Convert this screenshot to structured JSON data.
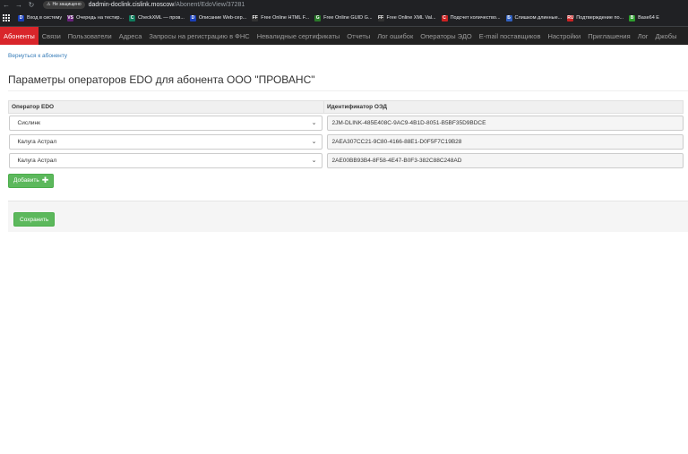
{
  "browser": {
    "security_label": "Не защищено",
    "url_host": "dadmin-doclink.cislink.moscow",
    "url_path": "/Abonent/EdoView/37281",
    "bookmarks": [
      {
        "label": "Вход в систему",
        "icon": "D",
        "color": "#1a3fb8"
      },
      {
        "label": "Очередь на тестир...",
        "icon": "VS",
        "color": "#68217a"
      },
      {
        "label": "CheckXML — пров...",
        "icon": "C",
        "color": "#0f7b5c"
      },
      {
        "label": "Описание Web-сер...",
        "icon": "D",
        "color": "#1a3fb8"
      },
      {
        "label": "Free Online HTML F...",
        "icon": "FF",
        "color": "#333333"
      },
      {
        "label": "Free Online GUID G...",
        "icon": "G",
        "color": "#2a7a2a"
      },
      {
        "label": "Free Online XML Val...",
        "icon": "FF",
        "color": "#333333"
      },
      {
        "label": "Подсчет количество...",
        "icon": "C",
        "color": "#cc2222"
      },
      {
        "label": "Слишком длинные...",
        "icon": "Б",
        "color": "#3060c0"
      },
      {
        "label": "Подтверждение по...",
        "icon": "RU",
        "color": "#cc2222"
      },
      {
        "label": "Base64 E",
        "icon": "B",
        "color": "#2e9e2e"
      }
    ]
  },
  "navbar": {
    "items": [
      "Абоненты",
      "Связи",
      "Пользователи",
      "Адреса",
      "Запросы на регистрацию в ФНС",
      "Невалидные сертификаты",
      "Отчеты",
      "Лог ошибок",
      "Операторы ЭДО",
      "E-mail поставщиков",
      "Настройки",
      "Приглашения",
      "Лог",
      "Джобы"
    ]
  },
  "page": {
    "back_link": "Вернуться к абоненту",
    "title": "Параметры операторов EDO для абонента ООО \"ПРОВАНС\"",
    "col_operator": "Оператор EDO",
    "col_identifier": "Идентификатор ОЭД",
    "rows": [
      {
        "operator": "Сислинк",
        "identifier": "2JM-DLINK-485E408C-9AC9-4B1D-8051-B5BF35D9BDCE"
      },
      {
        "operator": "Калуга Астрал",
        "identifier": "2AEA307CC21-9C80-4166-88E1-D0F5F7C19B28"
      },
      {
        "operator": "Калуга Астрал",
        "identifier": "2AE00BB93B4-8F58-4E47-B0F3-382C88C248AD"
      }
    ],
    "add_label": "Добавить",
    "save_label": "Сохранить"
  }
}
